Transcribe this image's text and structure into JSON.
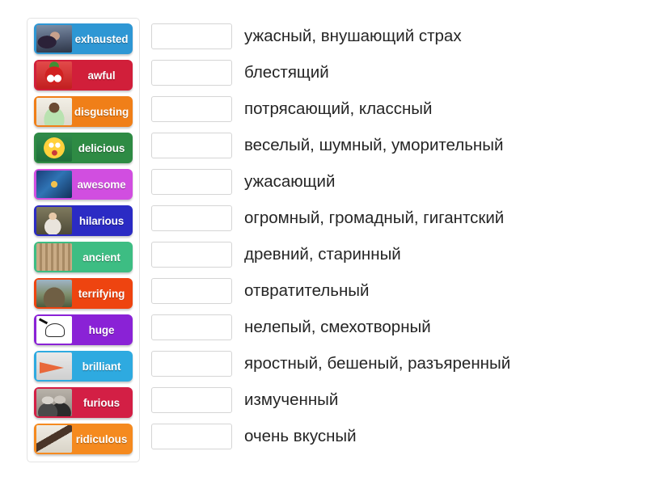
{
  "exercise": {
    "type": "match-up",
    "cards": [
      {
        "label": "exhausted",
        "color": "#2e97d4",
        "thumb": "t-exhausted",
        "thumb_icon": "photo-person-sleeping-on-books"
      },
      {
        "label": "awful",
        "color": "#d11f3a",
        "thumb": "t-awful",
        "thumb_icon": "photo-red-monster-tomato"
      },
      {
        "label": "disgusting",
        "color": "#f07f18",
        "thumb": "t-disgusting",
        "thumb_icon": "photo-girl-making-face"
      },
      {
        "label": "delicious",
        "color": "#2e8b44",
        "thumb": "t-delicious",
        "thumb_icon": "emoji-yummy-face"
      },
      {
        "label": "awesome",
        "color": "#d14ee0",
        "thumb": "t-awesome",
        "thumb_icon": "photo-framed-painting"
      },
      {
        "label": "hilarious",
        "color": "#2b2bc4",
        "thumb": "t-hilarious",
        "thumb_icon": "photo-laughing-people"
      },
      {
        "label": "ancient",
        "color": "#3dbd83",
        "thumb": "t-ancient",
        "thumb_icon": "photo-colosseum"
      },
      {
        "label": "terrifying",
        "color": "#ee4410",
        "thumb": "t-terrifying",
        "thumb_icon": "photo-wild-animals"
      },
      {
        "label": "huge",
        "color": "#8a22d6",
        "thumb": "t-huge",
        "thumb_icon": "drawing-elephant"
      },
      {
        "label": "brilliant",
        "color": "#2eaae0",
        "thumb": "t-brilliant",
        "thumb_icon": "drawing-paper-plane"
      },
      {
        "label": "furious",
        "color": "#d31f45",
        "thumb": "t-furious",
        "thumb_icon": "photo-arguing-couple"
      },
      {
        "label": "ridiculous",
        "color": "#f58a1f",
        "thumb": "t-ridiculous",
        "thumb_icon": "photo-high-heel-shoe"
      }
    ],
    "rows": [
      {
        "answer": "",
        "definition": "ужасный, внушающий страх"
      },
      {
        "answer": "",
        "definition": "блестящий"
      },
      {
        "answer": "",
        "definition": "потрясающий, классный"
      },
      {
        "answer": "",
        "definition": "веселый, шумный, уморительный"
      },
      {
        "answer": "",
        "definition": "ужасающий"
      },
      {
        "answer": "",
        "definition": "огромный, громадный, гигантский"
      },
      {
        "answer": "",
        "definition": "древний, старинный"
      },
      {
        "answer": "",
        "definition": "отвратительный"
      },
      {
        "answer": "",
        "definition": "нелепый, смехотворный"
      },
      {
        "answer": "",
        "definition": "яростный, бешеный, разъяренный"
      },
      {
        "answer": "",
        "definition": "измученный"
      },
      {
        "answer": "",
        "definition": "очень вкусный"
      }
    ]
  },
  "colors": {
    "page_background": "#ffffff",
    "panel_border": "#e3e3e3",
    "dropbox_border": "#d5d5d5",
    "definition_text": "#252525",
    "card_text": "#ffffff"
  }
}
